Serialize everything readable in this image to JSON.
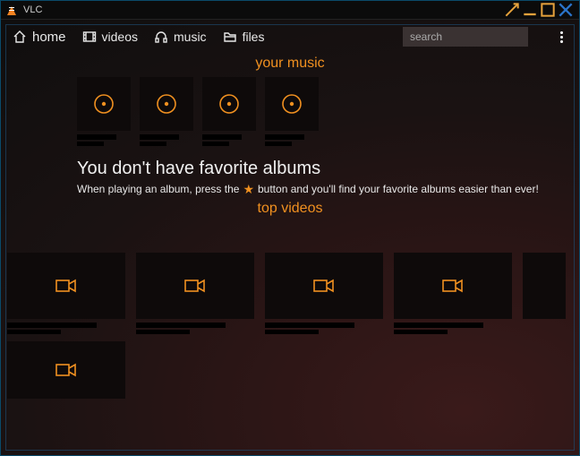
{
  "window": {
    "title": "VLC"
  },
  "nav": {
    "home": "home",
    "videos": "videos",
    "music": "music",
    "files": "files"
  },
  "search": {
    "placeholder": "search"
  },
  "sections": {
    "your_music": "your music",
    "top_videos": "top videos"
  },
  "favorites": {
    "heading": "You don't have favorite albums",
    "sub_before": "When playing an album, press the",
    "sub_after": "button and you'll find your favorite albums easier than ever!"
  },
  "colors": {
    "accent": "#f09020"
  }
}
